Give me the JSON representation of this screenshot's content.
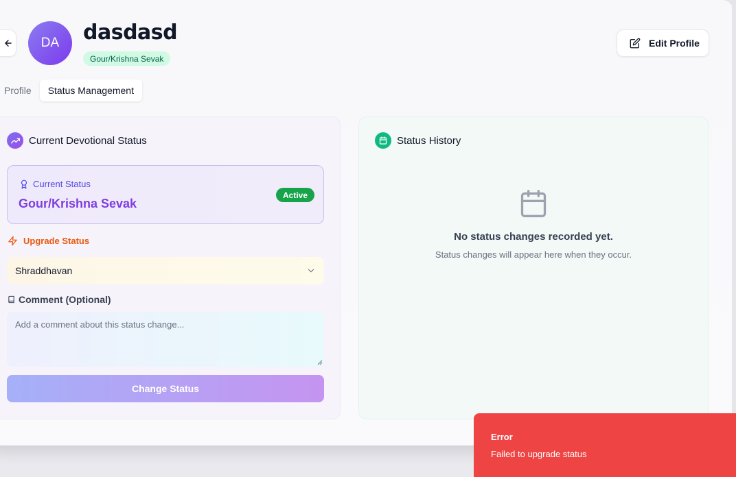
{
  "header": {
    "avatar_initials": "DA",
    "user_name": "dasdasd",
    "role_badge": "Gour/Krishna Sevak",
    "edit_label": "Edit Profile"
  },
  "tabs": [
    {
      "label": "Profile",
      "active": false
    },
    {
      "label": "Status Management",
      "active": true
    }
  ],
  "left_panel": {
    "title": "Current Devotional Status",
    "current_status_label": "Current Status",
    "current_status_value": "Gour/Krishna Sevak",
    "active_badge": "Active",
    "upgrade_label": "Upgrade Status",
    "select_value": "Shraddhavan",
    "comment_label": "Comment (Optional)",
    "comment_placeholder": "Add a comment about this status change...",
    "button_label": "Change Status"
  },
  "right_panel": {
    "title": "Status History",
    "empty_title": "No status changes recorded yet.",
    "empty_subtitle": "Status changes will appear here when they occur."
  },
  "toast": {
    "title": "Error",
    "message": "Failed to upgrade status"
  },
  "colors": {
    "accent_purple": "#7e3fe0",
    "success_green": "#16a34a",
    "warning_orange": "#ea580c",
    "error_red": "#ef4444",
    "history_teal": "#10b981"
  },
  "icons": {
    "back": "arrow-left-icon",
    "edit": "edit-icon",
    "trend": "trending-up-icon",
    "award": "award-icon",
    "zap": "zap-icon",
    "book": "book-icon",
    "calendar": "calendar-icon",
    "chevron": "chevron-down-icon"
  }
}
